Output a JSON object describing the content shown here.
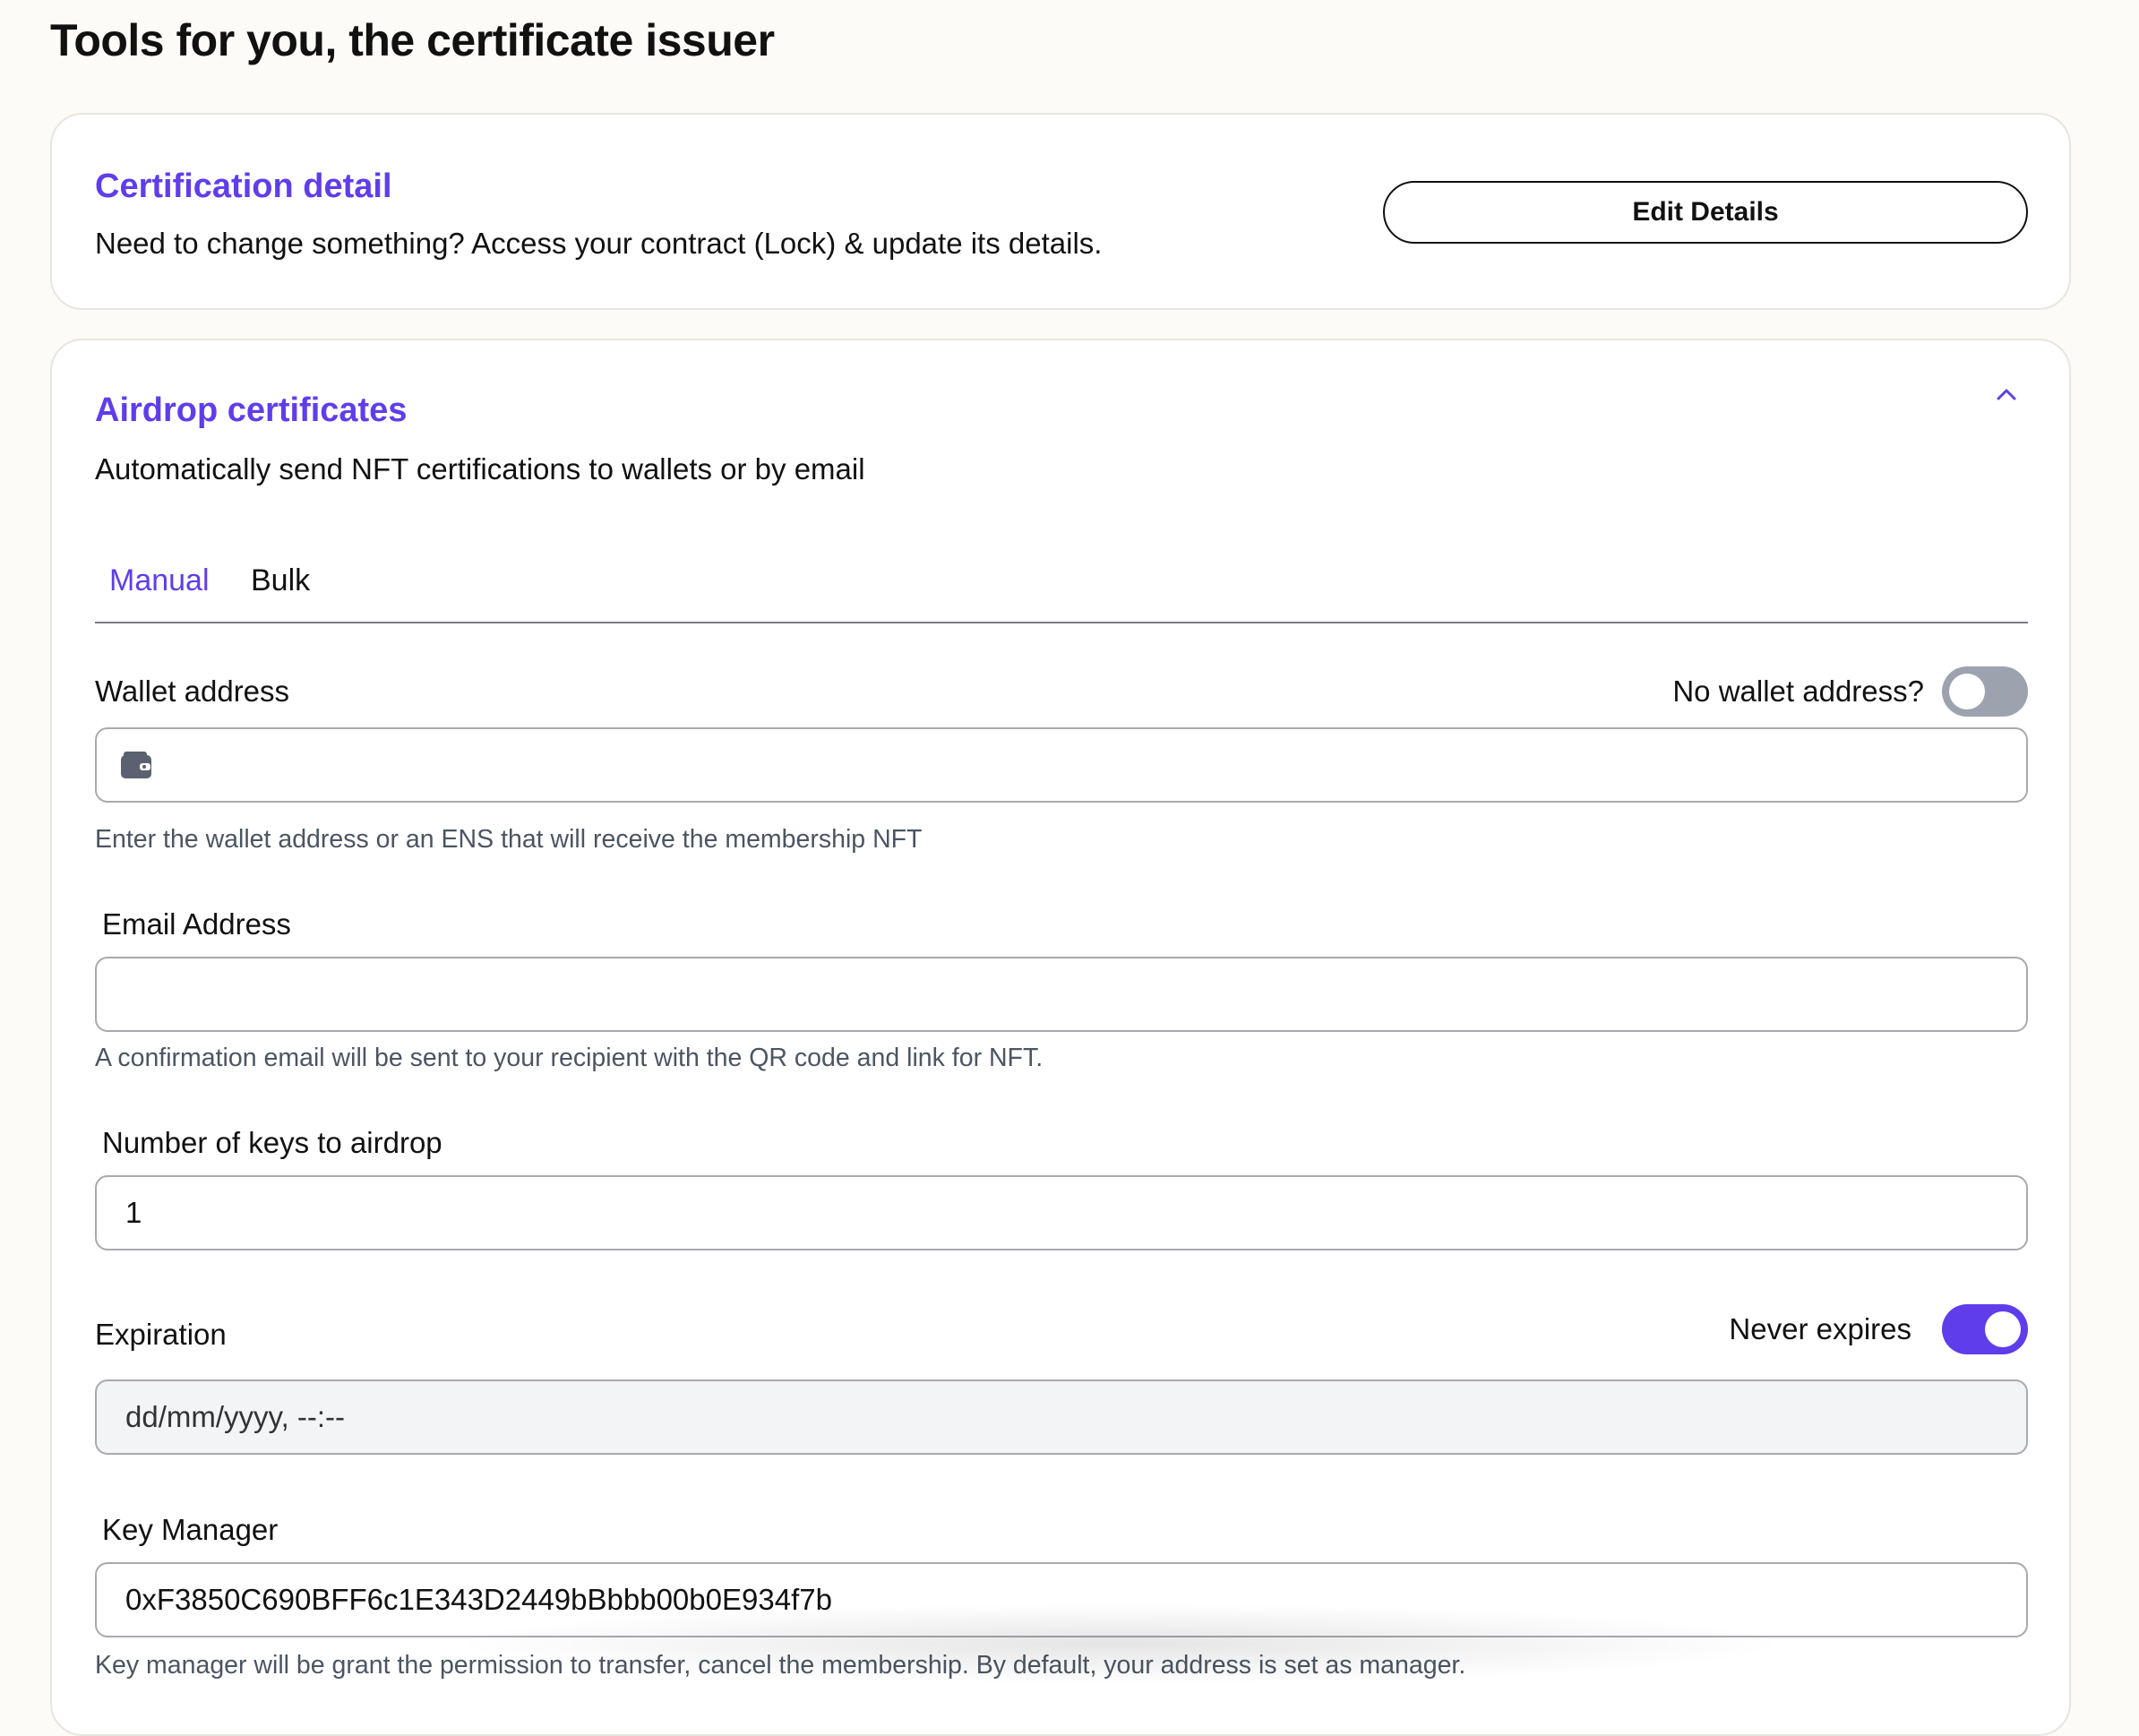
{
  "page": {
    "title": "Tools for you, the certificate issuer"
  },
  "certification_detail": {
    "heading": "Certification detail",
    "description": "Need to change something? Access your contract (Lock) & update its details.",
    "edit_button_label": "Edit Details"
  },
  "airdrop": {
    "heading": "Airdrop certificates",
    "description": "Automatically send NFT certifications to wallets or by email",
    "collapse_icon": "chevron-up-icon",
    "tabs": [
      {
        "label": "Manual",
        "active": true
      },
      {
        "label": "Bulk",
        "active": false
      }
    ],
    "wallet": {
      "label": "Wallet address",
      "toggle_label": "No wallet address?",
      "toggle_on": false,
      "icon": "wallet-icon",
      "value": "",
      "help": "Enter the wallet address or an ENS that will receive the membership NFT"
    },
    "email": {
      "label": "Email Address",
      "value": "",
      "help": "A confirmation email will be sent to your recipient with the QR code and link for NFT."
    },
    "keys": {
      "label": "Number of keys to airdrop",
      "value": "1"
    },
    "expiration": {
      "label": "Expiration",
      "toggle_label": "Never expires",
      "toggle_on": true,
      "value": "dd/mm/yyyy, --:--"
    },
    "key_manager": {
      "label": "Key Manager",
      "value": "0xF3850C690BFF6c1E343D2449bBbbb00b0E934f7b",
      "help": "Key manager will be grant the permission to transfer, cancel the membership. By default, your address is set as manager."
    }
  },
  "colors": {
    "accent": "#603deb",
    "background": "#fcfbf7",
    "card": "#ffffff",
    "toggle_off": "#9ca3af",
    "help_text": "#4b5563"
  }
}
